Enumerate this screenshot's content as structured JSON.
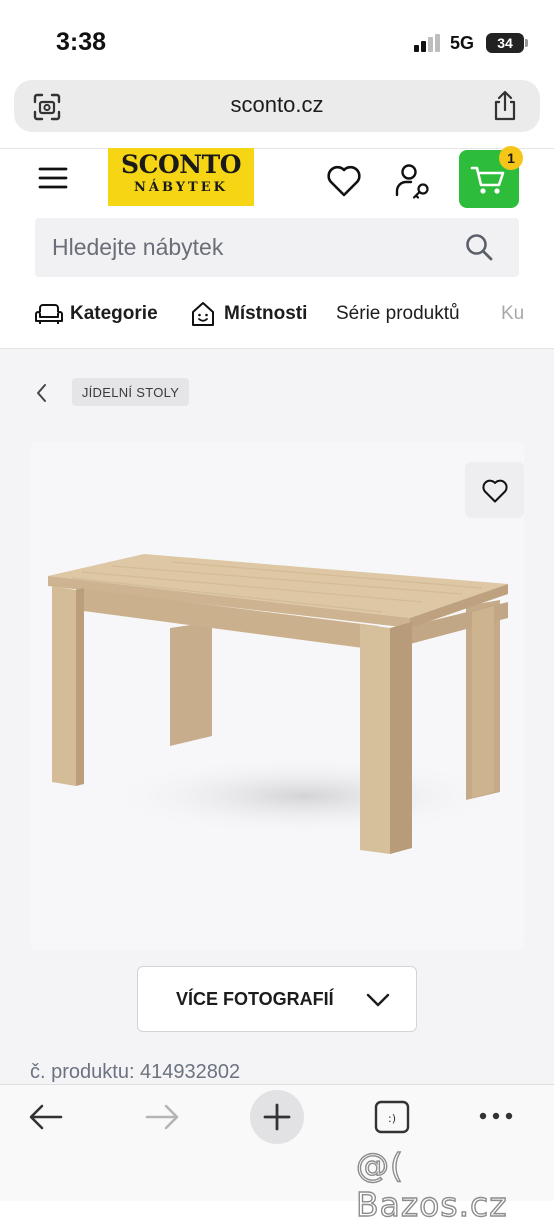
{
  "status_bar": {
    "time": "3:38",
    "network": "5G",
    "battery": "34"
  },
  "browser": {
    "url": "sconto.cz"
  },
  "header": {
    "logo_line1": "SCONTO",
    "logo_line2": "NÁBYTEK",
    "cart_count": "1",
    "colors": {
      "logo_bg": "#f5d514",
      "cart_bg": "#2ebd3b",
      "badge_bg": "#f5c518"
    }
  },
  "search": {
    "placeholder": "Hledejte nábytek"
  },
  "nav": {
    "items": [
      "Kategorie",
      "Místnosti",
      "Série produktů",
      "Ku"
    ]
  },
  "breadcrumb": {
    "label": "JÍDELNÍ STOLY"
  },
  "product": {
    "more_photos_label": "VÍCE FOTOGRAFIÍ",
    "code_text": "č. produktu: 414932802"
  },
  "watermark": "@( Bazos.cz"
}
